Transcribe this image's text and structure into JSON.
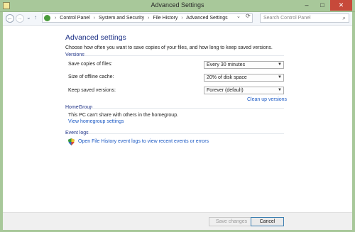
{
  "window": {
    "title": "Advanced Settings",
    "minimize": "–",
    "maximize": "□",
    "close": "✕"
  },
  "addressbar": {
    "back": "←",
    "forward": "→",
    "recent": "⌄",
    "up": "↑",
    "crumbs": [
      "Control Panel",
      "System and Security",
      "File History",
      "Advanced Settings"
    ],
    "dropdown": "⌄",
    "refresh": "⟳",
    "search_placeholder": "Search Control Panel",
    "search_icon": "⌕"
  },
  "content": {
    "title": "Advanced settings",
    "description": "Choose how often you want to save copies of your files, and how long to keep saved versions.",
    "versions": {
      "header": "Versions",
      "rows": [
        {
          "label": "Save copies of files:",
          "value": "Every 30 minutes"
        },
        {
          "label": "Size of offline cache:",
          "value": "20% of disk space"
        },
        {
          "label": "Keep saved versions:",
          "value": "Forever (default)"
        }
      ],
      "cleanup_link": "Clean up versions"
    },
    "homegroup": {
      "header": "HomeGroup",
      "text": "This PC can't share with others in the homegroup.",
      "link": "View homegroup settings"
    },
    "eventlogs": {
      "header": "Event logs",
      "link": "Open File History event logs to view recent events or errors"
    }
  },
  "footer": {
    "save_label": "Save changes",
    "cancel_label": "Cancel"
  },
  "colors": {
    "frame": "#a8c89a",
    "heading": "#1e3287",
    "link": "#1b59c4",
    "close": "#c7493a"
  },
  "icons": {
    "app": "control-panel-icon",
    "shield": "shield-icon"
  }
}
